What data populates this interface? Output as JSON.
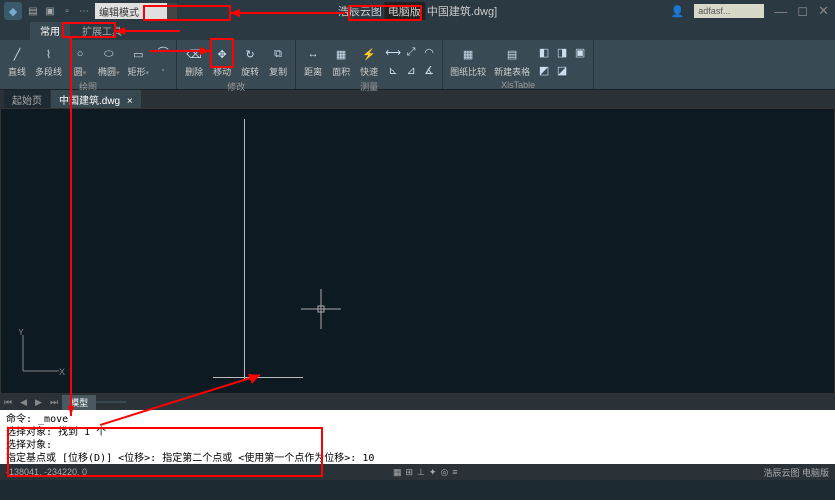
{
  "title": {
    "app": "浩辰云图",
    "edition": "电脑版",
    "doc": "中国建筑.dwg]"
  },
  "user_box": "adfasf...",
  "search_text": "编辑模式",
  "tabs": {
    "t0": "常用",
    "t1": "扩展工具"
  },
  "ribbon": {
    "draw": {
      "label": "绘图",
      "line": "直线",
      "pline": "多段线",
      "circle": "圆",
      "ellipse": "椭圆",
      "rect": "矩形"
    },
    "mod": {
      "label": "修改",
      "erase": "删除",
      "move": "移动",
      "rotate": "旋转",
      "copy": "复制"
    },
    "meas": {
      "label": "测量",
      "dist": "距离",
      "area": "面积",
      "quick": "快速"
    },
    "comp": {
      "label": "图纸比较",
      "a": "图纸比较",
      "b": "新建表格",
      "c": "XlsTable"
    }
  },
  "doc_tabs": {
    "start": "起始页",
    "active": "中国建筑.dwg"
  },
  "layout": {
    "model": "模型"
  },
  "cmd": {
    "l1": "命令: _move",
    "l2": "选择对象: 找到 1 个",
    "l3": "选择对象:",
    "l4": "指定基点或 [位移(D)] <位移>:   指定第二个点或 <使用第一个点作为位移>: 10"
  },
  "status": {
    "coords": "-138041, -234220, 0",
    "right": "浩辰云图 电脑版"
  }
}
